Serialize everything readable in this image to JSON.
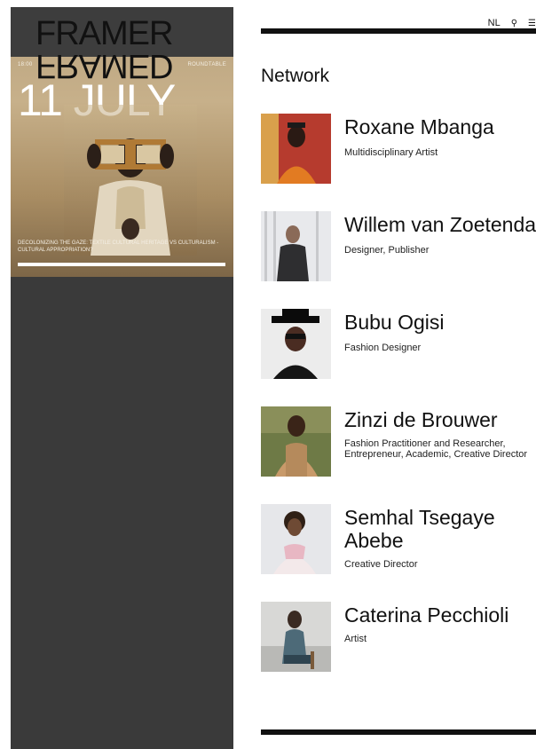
{
  "event": {
    "logo_top": "FRAMER",
    "logo_bottom": "FRAMED",
    "meta_left": "18:00",
    "meta_right": "ROUNDTABLE",
    "date": "11 JULY",
    "caption": "DECOLONIZING THE GAZE: TEXTILE CULTURAL HERITAGE VS CULTURALISM - CULTURAL APPROPRIATION?",
    "progress_fraction": 1.0
  },
  "header": {
    "nav_lang": "NL",
    "nav_search": "search-icon",
    "nav_menu": "menu-icon"
  },
  "section": {
    "title": "Network"
  },
  "people": [
    {
      "name": "Roxane Mbanga",
      "role": "Multidisciplinary Artist"
    },
    {
      "name": "Willem van Zoetendaal",
      "role": "Designer, Publisher"
    },
    {
      "name": "Bubu Ogisi",
      "role": "Fashion Designer"
    },
    {
      "name": "Zinzi de Brouwer",
      "role": "Fashion Practitioner and Researcher, Entrepreneur, Academic, Creative Director"
    },
    {
      "name": "Semhal Tsegaye Abebe",
      "role": "Creative Director"
    },
    {
      "name": "Caterina Pecchioli",
      "role": "Artist"
    }
  ]
}
